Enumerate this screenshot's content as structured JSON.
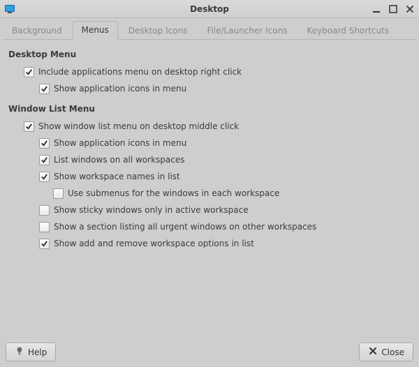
{
  "window": {
    "title": "Desktop"
  },
  "tabs": {
    "background": "Background",
    "menus": "Menus",
    "desktop_icons": "Desktop Icons",
    "file_launcher_icons": "File/Launcher Icons",
    "keyboard_shortcuts": "Keyboard Shortcuts",
    "active": "menus"
  },
  "sections": {
    "desktop_menu": {
      "title": "Desktop Menu",
      "include_apps_menu": {
        "label": "Include applications menu on desktop right click",
        "checked": true
      },
      "show_app_icons": {
        "label": "Show application icons in menu",
        "checked": true
      }
    },
    "window_list_menu": {
      "title": "Window List Menu",
      "show_window_list": {
        "label": "Show window list menu on desktop middle click",
        "checked": true
      },
      "show_app_icons": {
        "label": "Show application icons in menu",
        "checked": true
      },
      "list_all_workspaces": {
        "label": "List windows on all workspaces",
        "checked": true
      },
      "show_ws_names": {
        "label": "Show workspace names in list",
        "checked": true
      },
      "use_submenus": {
        "label": "Use submenus for the windows in each workspace",
        "checked": false
      },
      "sticky_active_only": {
        "label": "Show sticky windows only in active workspace",
        "checked": false
      },
      "urgent_other_ws": {
        "label": "Show a section listing all urgent windows on other workspaces",
        "checked": false
      },
      "show_add_remove_ws": {
        "label": "Show add and remove workspace options in list",
        "checked": true
      }
    }
  },
  "buttons": {
    "help": "Help",
    "close": "Close"
  }
}
